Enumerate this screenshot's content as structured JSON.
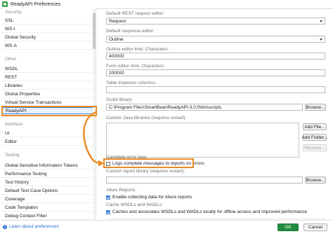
{
  "window": {
    "title": "ReadyAPI Preferences"
  },
  "sidebar": {
    "rows": [
      {
        "label": "Security",
        "kind": "cat"
      },
      {
        "label": "SSL",
        "kind": "item"
      },
      {
        "label": "WS-I",
        "kind": "item"
      },
      {
        "label": "Global Security",
        "kind": "item"
      },
      {
        "label": "WS-A",
        "kind": "item"
      },
      {
        "label": "Other",
        "kind": "cat"
      },
      {
        "label": "WSDL",
        "kind": "item"
      },
      {
        "label": "REST",
        "kind": "item"
      },
      {
        "label": "Libraries",
        "kind": "item"
      },
      {
        "label": "Global Properties",
        "kind": "item"
      },
      {
        "label": "Virtual Service Transactions",
        "kind": "item"
      },
      {
        "label": "ReadyAPI",
        "kind": "selected"
      },
      {
        "label": "Interface",
        "kind": "cat"
      },
      {
        "label": "UI",
        "kind": "item"
      },
      {
        "label": "Editor",
        "kind": "item"
      },
      {
        "label": "Testing",
        "kind": "cat"
      },
      {
        "label": "Global Sensitive Information Tokens",
        "kind": "item"
      },
      {
        "label": "Performance Testing",
        "kind": "item"
      },
      {
        "label": "Test History",
        "kind": "item"
      },
      {
        "label": "Default Test Case Options",
        "kind": "item"
      },
      {
        "label": "Coverage",
        "kind": "item"
      },
      {
        "label": "Code Templates",
        "kind": "item"
      },
      {
        "label": "Debug Context Filter",
        "kind": "item"
      }
    ]
  },
  "main": {
    "default_rest_request_editor": {
      "label": "Default REST request editor:",
      "value": "Request"
    },
    "default_response_editor": {
      "label": "Default response editor:",
      "value": "Outline"
    },
    "outline_editor_limit": {
      "label": "Outline editor limit, Characters:",
      "value": "400000"
    },
    "form_editor_limit": {
      "label": "Form editor limit, Characters:",
      "value": "200000"
    },
    "table_inspector_columns": {
      "label": "Table inspector columns:",
      "value": ""
    },
    "script_library": {
      "label": "Script library:",
      "value": "C:\\Program Files\\SmartBear\\ReadyAPI-3.0.0\\bin\\scripts",
      "browse": "Browse..."
    },
    "custom_java_libraries": {
      "label": "Custom Java libraries (requires restart):",
      "add_file": "Add File...",
      "add_folder": "Add Folder...",
      "remove": "Remove..."
    },
    "complete_error_logs": {
      "label": "Complete error logs:",
      "checkbox": "Logs complete messages to reports on errors",
      "checked": false
    },
    "custom_report_library": {
      "label": "Custom report library (requires restart):",
      "value": "",
      "browse": "Browse..."
    },
    "allure_reports": {
      "label": "Allure Reports:",
      "checkbox": "Enable collecting data for Allure reports",
      "checked": true
    },
    "cache_wsdls": {
      "label": "Cache WSDLs and WADLs:",
      "checkbox": "Caches and associates WSDLs and WADLs locally for offline access and improved performance",
      "checked": true
    }
  },
  "footer": {
    "learn_more": "Learn about preferences",
    "ok": "OK",
    "cancel": "Cancel"
  },
  "colors": {
    "highlight": "#ec8a24",
    "ok_button": "#1f8c3f",
    "accent": "#3b7ed6",
    "link": "#2a6fcf"
  }
}
